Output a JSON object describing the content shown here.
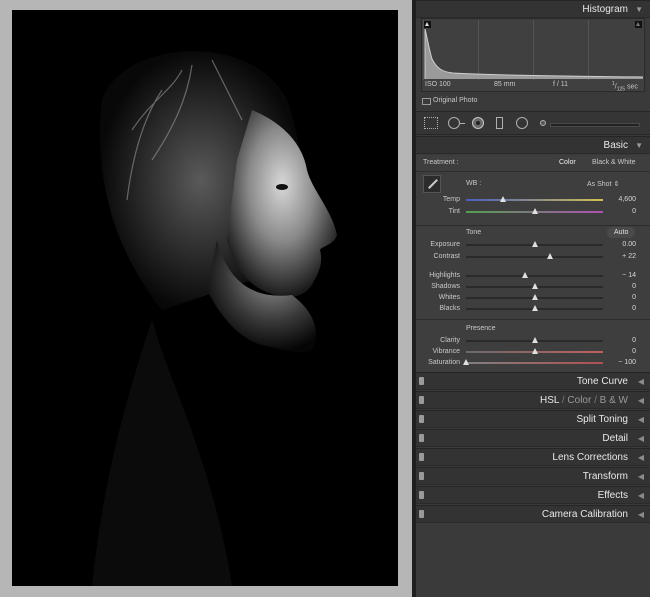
{
  "histogram": {
    "title": "Histogram",
    "iso": "ISO 100",
    "focal": "85 mm",
    "aperture": "f / 11",
    "shutter_num": "1",
    "shutter_den": "125",
    "shutter_unit": "sec",
    "original_photo": "Original Photo"
  },
  "basic": {
    "title": "Basic",
    "treatment_label": "Treatment :",
    "treatment_color": "Color",
    "treatment_bw": "Black & White",
    "wb_label": "WB :",
    "wb_value": "As Shot",
    "tone_label": "Tone",
    "auto_label": "Auto",
    "presence_label": "Presence",
    "sliders": [
      {
        "label": "Temp",
        "value": "4,600",
        "level": 0.27
      },
      {
        "label": "Tint",
        "value": "0",
        "level": 0.5
      },
      {
        "label": "Exposure",
        "value": "0.00",
        "level": 0.5
      },
      {
        "label": "Contrast",
        "value": "+ 22",
        "level": 0.61
      },
      {
        "label": "Highlights",
        "value": "− 14",
        "level": 0.43
      },
      {
        "label": "Shadows",
        "value": "0",
        "level": 0.5
      },
      {
        "label": "Whites",
        "value": "0",
        "level": 0.5
      },
      {
        "label": "Blacks",
        "value": "0",
        "level": 0.5
      },
      {
        "label": "Clarity",
        "value": "0",
        "level": 0.5
      },
      {
        "label": "Vibrance",
        "value": "0",
        "level": 0.5
      },
      {
        "label": "Saturation",
        "value": "− 100",
        "level": 0.0
      }
    ]
  },
  "panels": {
    "tone_curve": "Tone Curve",
    "hsl": "HSL",
    "color": "Color",
    "bw": "B & W",
    "split_toning": "Split Toning",
    "detail": "Detail",
    "lens_corrections": "Lens Corrections",
    "transform": "Transform",
    "effects": "Effects",
    "camera_calibration": "Camera Calibration"
  },
  "colors": {
    "panel": "#3a3a3a",
    "header": "#333333",
    "photo_bg": "#000000"
  },
  "icons": [
    "crop-overlay-icon",
    "spot-removal-icon",
    "red-eye-icon",
    "graduated-filter-icon",
    "radial-filter-icon",
    "adjustment-brush-icon",
    "eyedropper-icon"
  ]
}
